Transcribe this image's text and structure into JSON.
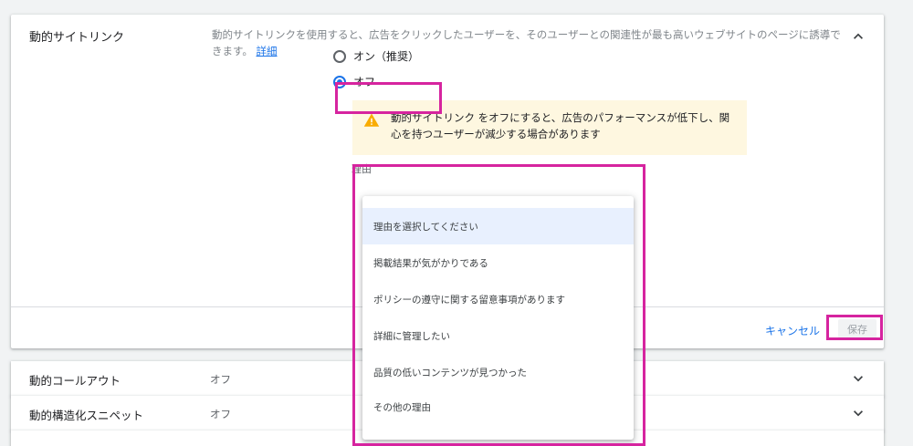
{
  "section": {
    "title": "動的サイトリンク",
    "description": "動的サイトリンクを使用すると、広告をクリックしたユーザーを、そのユーザーとの関連性が最も高いウェブサイトのページに誘導できます。",
    "details_link": "詳細",
    "options": {
      "on_label": "オン（推奨）",
      "off_label": "オフ"
    },
    "warning_text": "動的サイトリンク をオフにすると、広告のパフォーマンスが低下し、関心を持つユーザーが減少する場合があります",
    "reason_label": "理由",
    "reason_options": [
      "理由を選択してください",
      "掲載結果が気がかりである",
      "ポリシーの遵守に関する留意事項があります",
      "詳細に管理したい",
      "品質の低いコンテンツが見つかった",
      "その他の理由"
    ],
    "cancel_label": "キャンセル",
    "save_label": "保存"
  },
  "rows": [
    {
      "title": "動的コールアウト",
      "value": "オフ"
    },
    {
      "title": "動的構造化スニペット",
      "value": "オフ"
    }
  ],
  "colors": {
    "accent": "#1a73e8",
    "warning_bg": "#fef7e0",
    "warning_icon": "#f9ab00",
    "highlight": "#d6249f",
    "selected_item": "#e8f0fe"
  }
}
